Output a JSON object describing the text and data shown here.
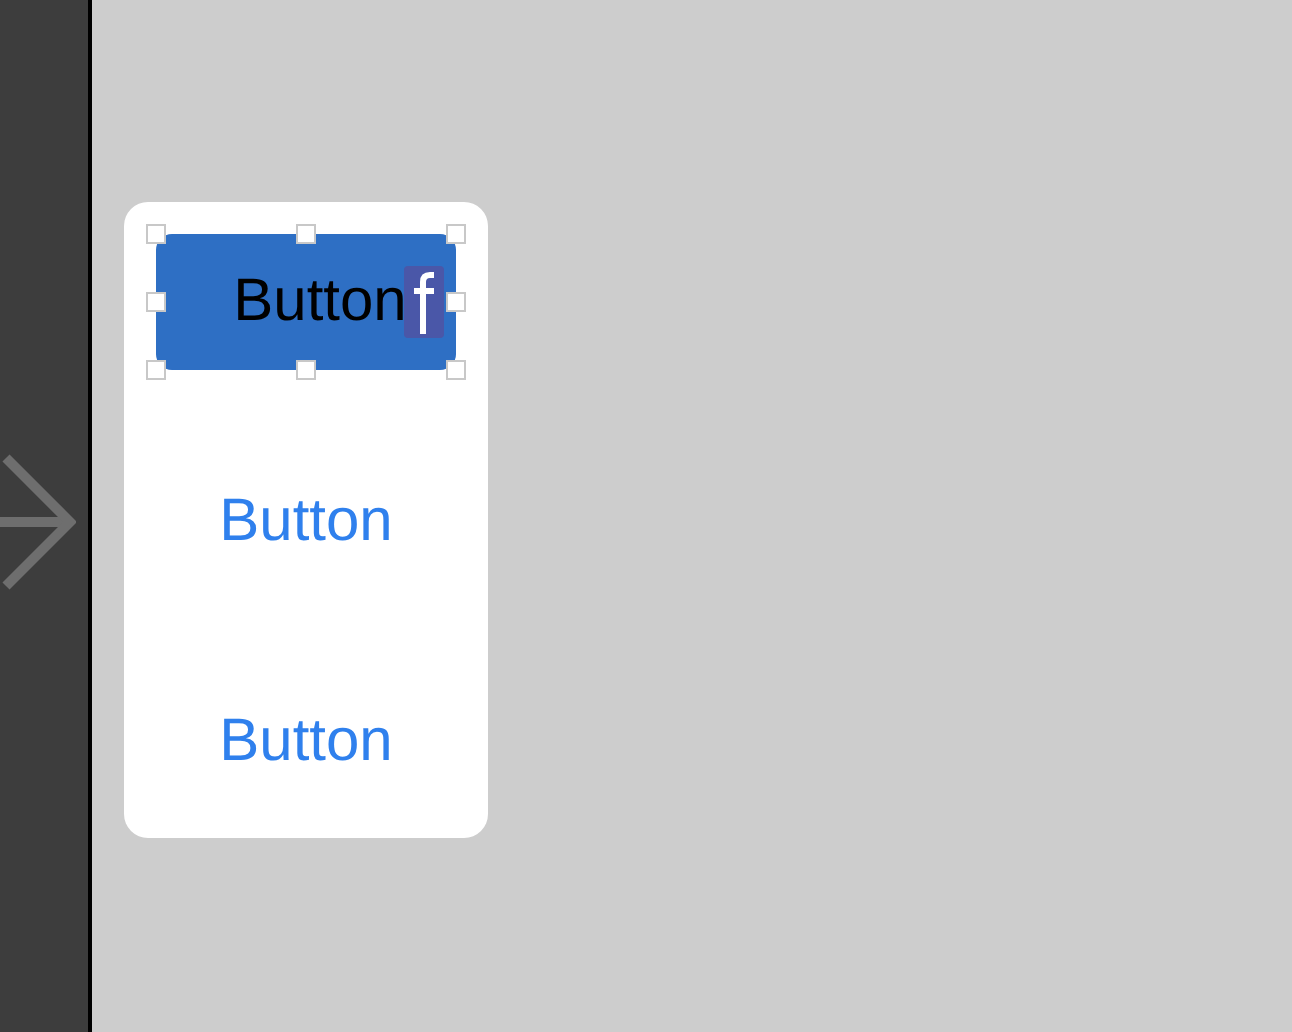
{
  "buttons": [
    {
      "label": "Button",
      "selected": true,
      "image": true
    },
    {
      "label": "Button",
      "selected": false,
      "image": false
    },
    {
      "label": "Button",
      "selected": false,
      "image": false
    }
  ]
}
